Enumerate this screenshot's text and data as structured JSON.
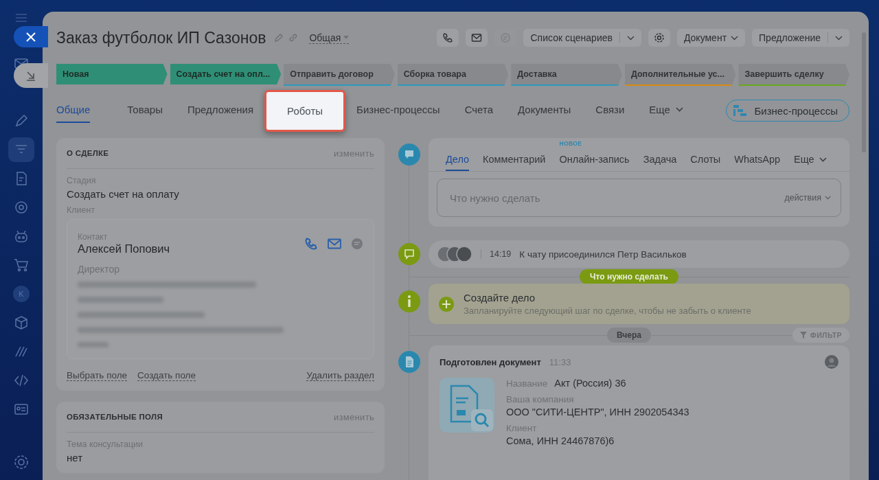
{
  "user_initial": "K",
  "title": "Заказ футболок ИП Сазонов",
  "category": "Общая",
  "header_buttons": [
    {
      "kind": "phone",
      "disabled": false
    },
    {
      "kind": "mail",
      "disabled": false
    },
    {
      "kind": "chat",
      "disabled": true
    },
    {
      "kind": "split",
      "label": "Список сценариев"
    },
    {
      "kind": "gear",
      "disabled": false
    },
    {
      "kind": "menu",
      "label": "Документ"
    },
    {
      "kind": "split",
      "label": "Предложение"
    }
  ],
  "stages": [
    {
      "label": "Новая",
      "passed": true,
      "color": "#2f8f76"
    },
    {
      "label": "Создать счет на опл...",
      "passed": true,
      "color": "#2f8f76"
    },
    {
      "label": "Отправить договор",
      "passed": false,
      "color": "#2d9ac0"
    },
    {
      "label": "Сборка товара",
      "passed": false,
      "color": "#2d9ac0"
    },
    {
      "label": "Доставка",
      "passed": false,
      "color": "#2d9ac0"
    },
    {
      "label": "Дополнительные ус...",
      "passed": false,
      "color": "#d98b10"
    },
    {
      "label": "Завершить сделку",
      "passed": false,
      "color": "#6aa81e"
    }
  ],
  "tabs": [
    {
      "label": "Общие",
      "selected": true,
      "highlighted": false,
      "has_menu": false
    },
    {
      "label": "Товары",
      "selected": false,
      "highlighted": false,
      "has_menu": false
    },
    {
      "label": "Предложения",
      "selected": false,
      "highlighted": false,
      "has_menu": false
    },
    {
      "label": "Роботы",
      "selected": false,
      "highlighted": true,
      "has_menu": false
    },
    {
      "label": "Бизнес-процессы",
      "selected": false,
      "highlighted": false,
      "has_menu": false
    },
    {
      "label": "Счета",
      "selected": false,
      "highlighted": false,
      "has_menu": false
    },
    {
      "label": "Документы",
      "selected": false,
      "highlighted": false,
      "has_menu": false
    },
    {
      "label": "Связи",
      "selected": false,
      "highlighted": false,
      "has_menu": false
    },
    {
      "label": "Еще",
      "selected": false,
      "highlighted": false,
      "has_menu": true
    }
  ],
  "bp_button": "Бизнес-процессы",
  "deal_card": {
    "heading": "О СДЕЛКЕ",
    "edit": "изменить",
    "stage_label": "Стадия",
    "stage_value": "Создать счет на оплату",
    "client_label": "Клиент",
    "contact": {
      "label": "Контакт",
      "name": "Алексей Попович",
      "position": "Директор"
    },
    "links": [
      "Выбрать поле",
      "Создать поле"
    ],
    "delete": "Удалить раздел"
  },
  "required_card": {
    "heading": "ОБЯЗАТЕЛЬНЫЕ ПОЛЯ",
    "edit": "изменить",
    "field_label": "Тема консультации",
    "field_value": "нет"
  },
  "activity_tabs": [
    {
      "label": "Дело",
      "selected": true
    },
    {
      "label": "Комментарий",
      "selected": false
    },
    {
      "label": "Онлайн-запись",
      "selected": false,
      "badge": "НОВОЕ"
    },
    {
      "label": "Задача",
      "selected": false
    },
    {
      "label": "Слоты",
      "selected": false
    },
    {
      "label": "WhatsApp",
      "selected": false
    },
    {
      "label": "Еще",
      "selected": false
    }
  ],
  "todo": {
    "placeholder": "Что нужно сделать",
    "actions": "действия"
  },
  "chat_event": {
    "time": "14:19",
    "text": "К чату присоединился Петр Васильков"
  },
  "todo_pill": "Что нужно сделать",
  "create_case": {
    "title": "Создайте дело",
    "hint": "Запланируйте следующий шаг по сделке, чтобы не забыть о клиенте"
  },
  "day_pill": "Вчера",
  "filter": "ФИЛЬТР",
  "document_event": {
    "title": "Подготовлен документ",
    "time": "11:33",
    "fields": [
      {
        "label": "Название",
        "value": "Акт (Россия) 36",
        "inline": true
      },
      {
        "label": "Ваша компания",
        "value": "ООО \"СИТИ-ЦЕНТР\", ИНН 2902054343",
        "inline": false
      },
      {
        "label": "Клиент",
        "value": "Сома, ИНН 24467876)6",
        "inline": false
      }
    ]
  }
}
